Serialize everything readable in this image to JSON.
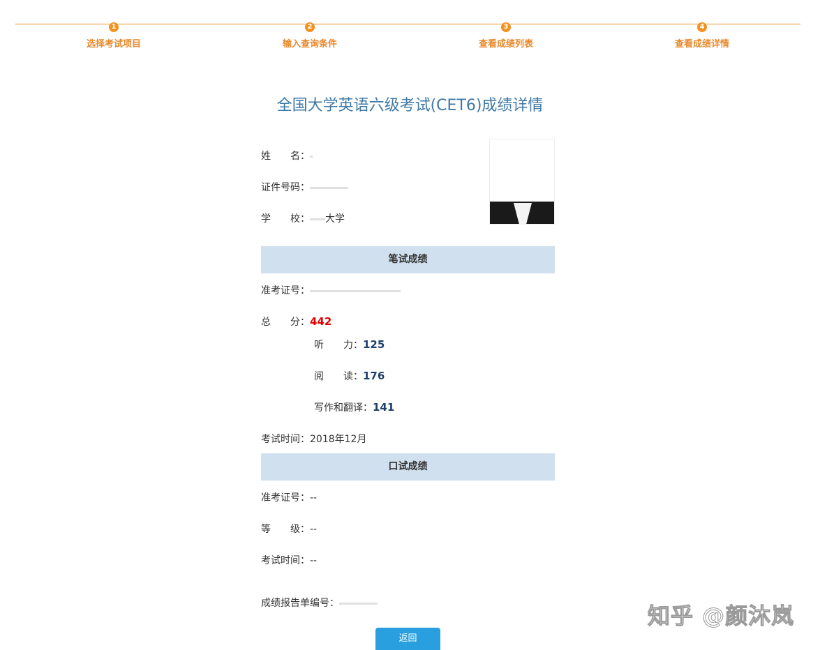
{
  "steps": [
    {
      "num": "1",
      "label": "选择考试项目"
    },
    {
      "num": "2",
      "label": "输入查询条件"
    },
    {
      "num": "3",
      "label": "查看成绩列表"
    },
    {
      "num": "4",
      "label": "查看成绩详情"
    }
  ],
  "title": "全国大学英语六级考试(CET6)成绩详情",
  "personal": {
    "name_label": "姓　　名：",
    "id_label": "证件号码：",
    "school_label": "学　　校：",
    "school_value": "大学"
  },
  "written": {
    "header": "笔试成绩",
    "ticket_label": "准考证号：",
    "total_label": "总　　分：",
    "total": "442",
    "listening_label": "听　　力：",
    "listening": "125",
    "reading_label": "阅　　读：",
    "reading": "176",
    "writing_label": "写作和翻译：",
    "writing": "141",
    "time_label": "考试时间：",
    "time": "2018年12月"
  },
  "oral": {
    "header": "口试成绩",
    "ticket_label": "准考证号：",
    "ticket": "--",
    "grade_label": "等　　级：",
    "grade": "--",
    "time_label": "考试时间：",
    "time": "--"
  },
  "report_label": "成绩报告单编号：",
  "back_button": "返回",
  "watermark": "知乎 @颜沐岚",
  "colors": {
    "step_accent": "#f19322",
    "title": "#3f79a6",
    "section_bg": "#d1e0ee",
    "total_score": "#e00000",
    "sub_score": "#1d3f6b",
    "button": "#2a9fe0"
  }
}
